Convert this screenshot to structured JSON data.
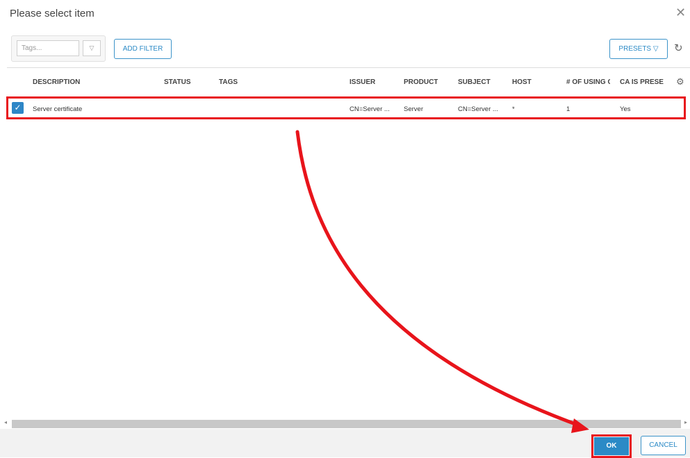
{
  "dialog": {
    "title": "Please select item",
    "close_glyph": "✕"
  },
  "toolbar": {
    "tags_placeholder": "Tags...",
    "tags_dropdown_glyph": "▽",
    "add_filter_label": "ADD FILTER",
    "presets_label": "PRESETS ▽",
    "refresh_icon": "refresh-icon"
  },
  "table": {
    "columns": [
      "DESCRIPTION",
      "STATUS",
      "TAGS",
      "ISSUER",
      "PRODUCT",
      "SUBJECT",
      "HOST",
      "# OF USING C",
      "CA IS PRESEN"
    ],
    "rows": [
      {
        "checked": true,
        "description": "Server certificate",
        "status": "",
        "tags": "",
        "issuer": "CN=Server ...",
        "product": "Server",
        "subject": "CN=Server ...",
        "host": "*",
        "using_count": "1",
        "ca_present": "Yes"
      }
    ],
    "settings_icon": "gear-icon"
  },
  "footer": {
    "ok_label": "OK",
    "cancel_label": "CANCEL"
  },
  "colors": {
    "accent": "#2b8ac6",
    "highlight": "#e8141b"
  }
}
